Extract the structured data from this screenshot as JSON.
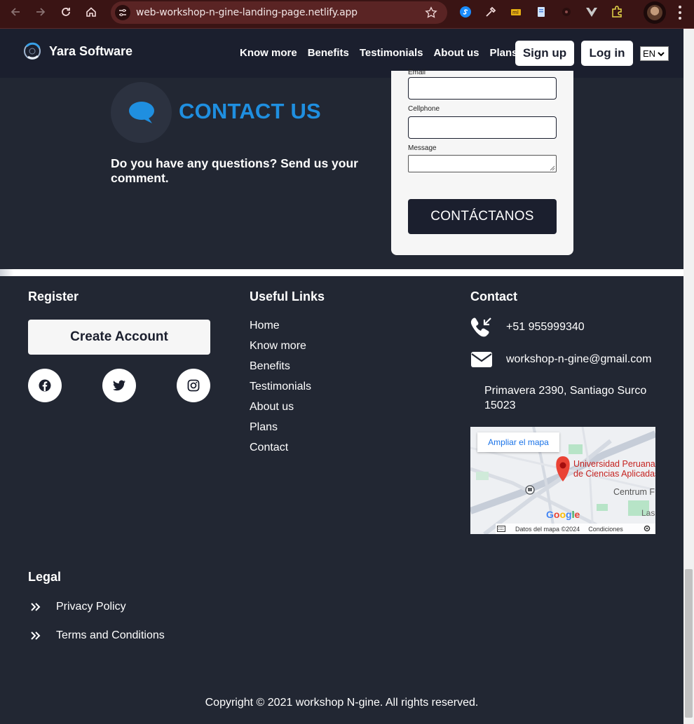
{
  "browser": {
    "url": "web-workshop-n-gine-landing-page.netlify.app"
  },
  "header": {
    "brand": "Yara Software",
    "nav": [
      "Know more",
      "Benefits",
      "Testimonials",
      "About us",
      "Plans"
    ],
    "signup": "Sign up",
    "login": "Log in",
    "language": "EN"
  },
  "contact": {
    "title": "CONTACT US",
    "subtitle": "Do you have any questions? Send us your comment.",
    "form": {
      "email_label": "Email",
      "cellphone_label": "Cellphone",
      "message_label": "Message",
      "submit": "CONTÁCTANOS"
    }
  },
  "footer": {
    "register": {
      "heading": "Register",
      "create_account": "Create Account"
    },
    "useful_links": {
      "heading": "Useful Links",
      "items": [
        "Home",
        "Know more",
        "Benefits",
        "Testimonials",
        "About us",
        "Plans",
        "Contact"
      ]
    },
    "contact": {
      "heading": "Contact",
      "phone": "+51 955999340",
      "email": "workshop-n-gine@gmail.com",
      "address": "Primavera 2390, Santiago Surco 15023",
      "map": {
        "expand": "Ampliar el mapa",
        "place_line1": "Universidad Peruana",
        "place_line2": "de Ciencias Aplicadas",
        "area": "Centrum F",
        "area2": "Las",
        "google": "Google",
        "data": "Datos del mapa ©2024",
        "terms": "Condiciones"
      }
    },
    "legal": {
      "heading": "Legal",
      "items": [
        "Privacy Policy",
        "Terms and Conditions"
      ]
    },
    "copyright": "Copyright © 2021 workshop N-gine. All rights reserved."
  },
  "colors": {
    "accent": "#1f8fe0",
    "background": "#222733",
    "header": "#1b1f2e",
    "chrome": "#3a1414"
  }
}
